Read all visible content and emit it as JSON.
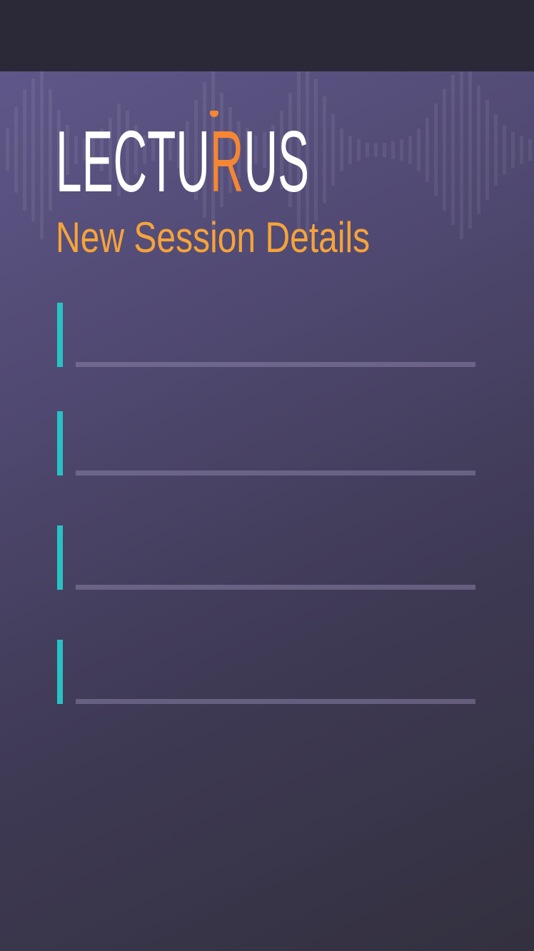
{
  "app": {
    "logo_text": "LECTURUS",
    "logo_accent_letter": "R",
    "subtitle": "New Session Details"
  },
  "form": {
    "fields": [
      {
        "value": ""
      },
      {
        "value": ""
      },
      {
        "value": ""
      },
      {
        "value": ""
      }
    ]
  },
  "colors": {
    "accent_orange": "#f5a33a",
    "logo_orange": "#f58634",
    "cursor_teal": "#27c3c4",
    "top_bar": "#2b2838"
  }
}
